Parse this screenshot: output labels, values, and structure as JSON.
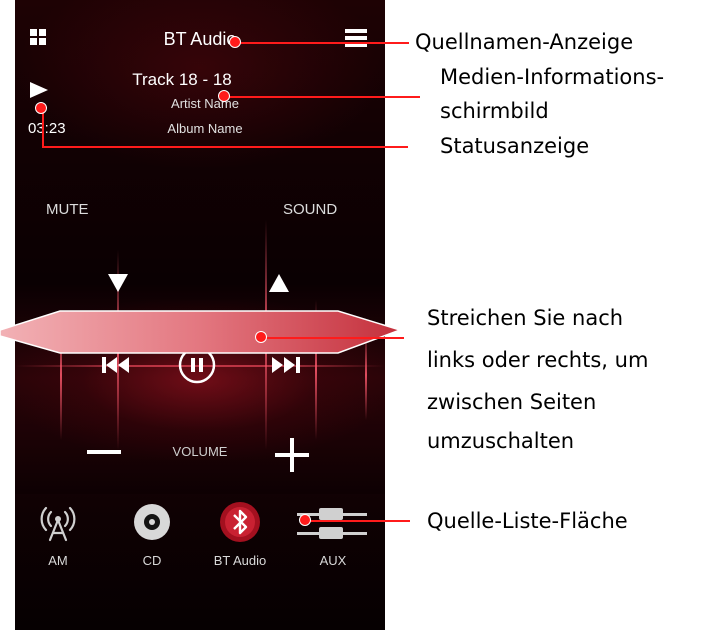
{
  "header": {
    "source_name": "BT Audio"
  },
  "media": {
    "track": "Track 18 - 18",
    "artist": "Artist Name",
    "album": "Album Name"
  },
  "status": {
    "time": "03:23"
  },
  "controls": {
    "mute_label": "MUTE",
    "sound_label": "SOUND",
    "volume_label": "VOLUME",
    "minus": "–",
    "plus": "+"
  },
  "sources": [
    {
      "label": "AM",
      "icon": "antenna-icon"
    },
    {
      "label": "CD",
      "icon": "disc-icon"
    },
    {
      "label": "BT Audio",
      "icon": "bluetooth-icon",
      "active": true
    },
    {
      "label": "AUX",
      "icon": "aux-cable-icon"
    }
  ],
  "callouts": {
    "source_name_display": "Quellnamen-Anzeige",
    "media_info_line1": "Medien-Informations-",
    "media_info_line2": "schirmbild",
    "status_display": "Statusanzeige",
    "swipe_line1": "Streichen Sie nach",
    "swipe_line2": "links oder rechts, um",
    "swipe_line3": "zwischen Seiten",
    "swipe_line4": "umzuschalten",
    "source_list_area": "Quelle-Liste-Fläche"
  },
  "colors": {
    "callout_red": "#ff1b1b",
    "swipe_band": "#e8868c",
    "screen_bg": "#120103"
  }
}
